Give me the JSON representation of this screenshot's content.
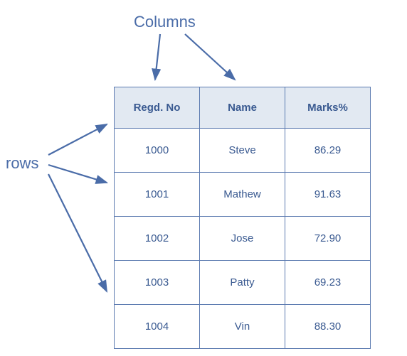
{
  "labels": {
    "columns": "Columns",
    "rows": "rows"
  },
  "table": {
    "headers": [
      "Regd. No",
      "Name",
      "Marks%"
    ],
    "rows": [
      {
        "regd": "1000",
        "name": "Steve",
        "marks": "86.29"
      },
      {
        "regd": "1001",
        "name": "Mathew",
        "marks": "91.63"
      },
      {
        "regd": "1002",
        "name": "Jose",
        "marks": "72.90"
      },
      {
        "regd": "1003",
        "name": "Patty",
        "marks": "69.23"
      },
      {
        "regd": "1004",
        "name": "Vin",
        "marks": "88.30"
      }
    ]
  },
  "colors": {
    "line": "#4a6ca8",
    "text": "#3a5a91",
    "headerBg": "#e2e9f2"
  }
}
